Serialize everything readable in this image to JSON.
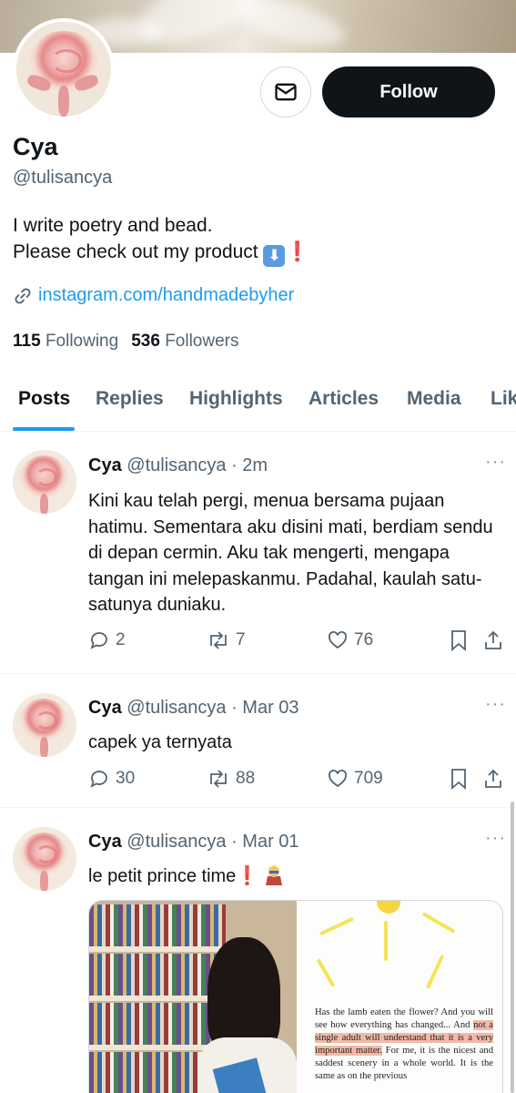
{
  "profile": {
    "name": "Cya",
    "handle": "@tulisancya",
    "bio_line1": "I write poetry and bead.",
    "bio_line2": "Please check out my product",
    "bio_arrow": "⬇",
    "bio_exclaim": "❗",
    "link": "instagram.com/handmadebyher",
    "following_count": "115",
    "following_label": "Following",
    "followers_count": "536",
    "followers_label": "Followers",
    "follow_label": "Follow"
  },
  "tabs": [
    "Posts",
    "Replies",
    "Highlights",
    "Articles",
    "Media",
    "Likes"
  ],
  "posts": [
    {
      "name": "Cya",
      "handle": "@tulisancya",
      "time": "· 2m",
      "text": "Kini kau telah pergi, menua bersama pujaan hatimu. Sementara aku disini mati, berdiam sendu di depan cermin. Aku tak mengerti, mengapa tangan ini melepaskanmu. Padahal, kaulah satu-satunya duniaku.",
      "replies": "2",
      "reposts": "7",
      "likes": "76"
    },
    {
      "name": "Cya",
      "handle": "@tulisancya",
      "time": "· Mar 03",
      "text": "capek ya ternyata",
      "replies": "30",
      "reposts": "88",
      "likes": "709"
    },
    {
      "name": "Cya",
      "handle": "@tulisancya",
      "time": "· Mar 01",
      "text": "le petit prince time",
      "exclaim": "❗",
      "page_text_before": "Has the lamb eaten the flower? And you will see how everything has changed... And ",
      "page_text_highlight": "not a single adult will understand that it is a very important matter.",
      "page_text_after": " For me, it is the nicest and saddest scenery in a whole world. It is the same as on the previous"
    }
  ],
  "colors": {
    "accent": "#1d9bf0",
    "text_primary": "#0f1419",
    "text_secondary": "#536471",
    "follow_bg": "#0f1419"
  },
  "icons": [
    "mail-icon",
    "link-icon",
    "reply-icon",
    "repost-icon",
    "like-icon",
    "bookmark-icon",
    "share-icon",
    "more-icon"
  ]
}
